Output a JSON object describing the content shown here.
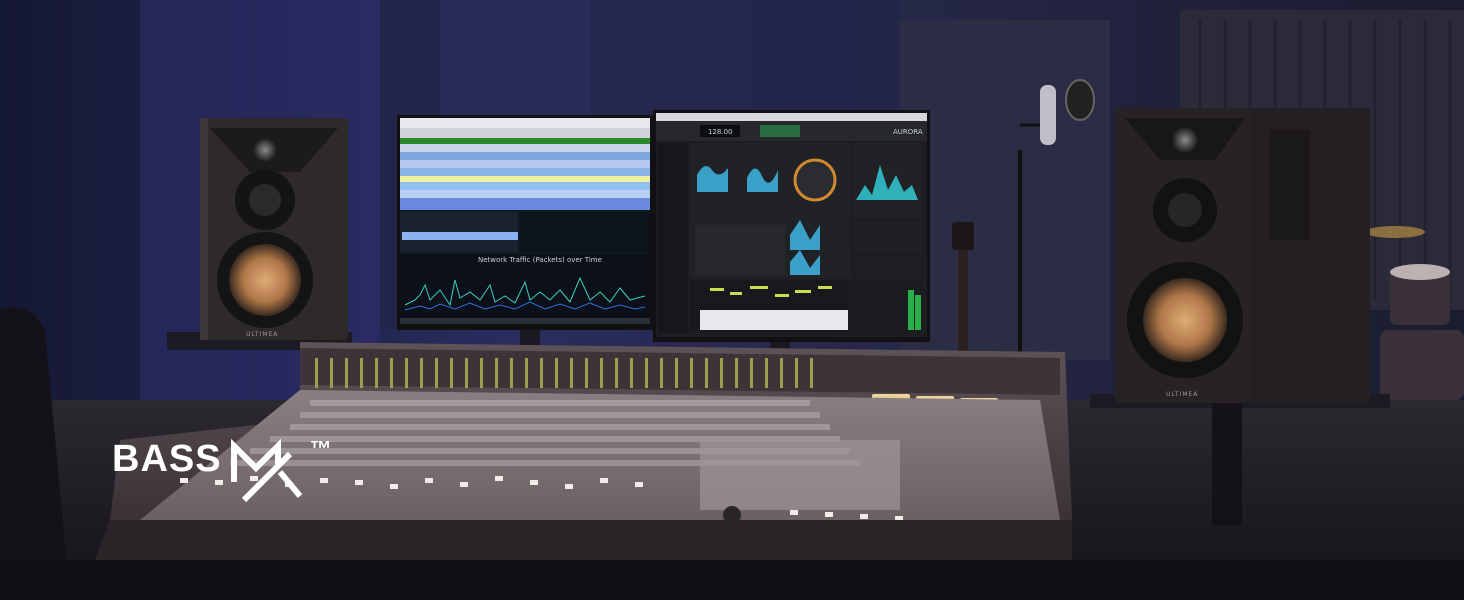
{
  "brand": {
    "name_text": "BASS",
    "mark_letters": "MX",
    "trademark": "™"
  },
  "speakers": {
    "left_label": "ULTIMEA",
    "right_label": "ULTIMEA"
  },
  "right_monitor": {
    "app_logo": "AURORA",
    "tempo": "128.00"
  },
  "left_monitor": {
    "chart_title": "Network Traffic (Packets) over Time"
  },
  "colors": {
    "room_wall": "#1d2038",
    "room_glow": "#3a3a86",
    "console_body": "#5a5054",
    "speaker_cone": "#c08a5a",
    "vu_meter": "#d8b880"
  },
  "icons": {
    "brand_mark": "mx-slash-logo",
    "left_monitor": "network-analyzer-window",
    "right_monitor": "daw-synth-window"
  }
}
